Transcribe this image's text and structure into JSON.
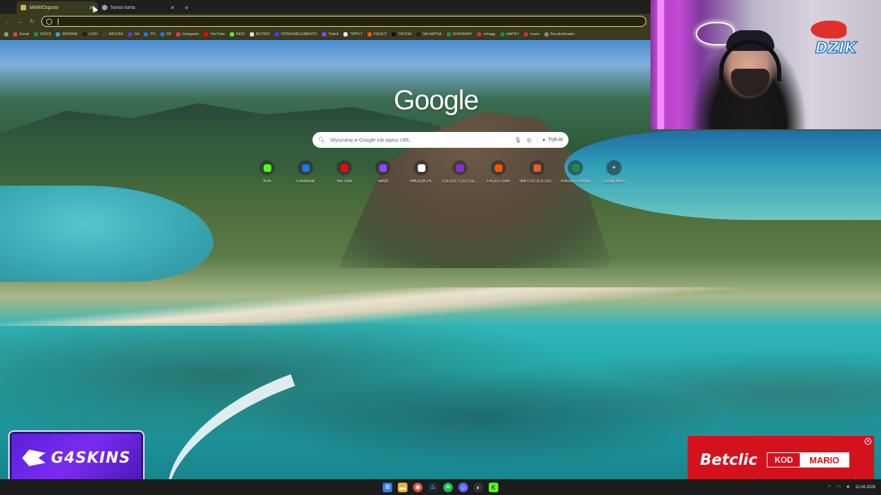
{
  "browser": {
    "tabs": [
      {
        "title": "MARIOspzoo",
        "active": true
      },
      {
        "title": "Nowa karta",
        "active": false
      }
    ],
    "new_tab_label": "+",
    "bookmarks": [
      {
        "label": "Gmail",
        "color": "#ea4335"
      },
      {
        "label": "DOCS",
        "color": "#1e8e3e"
      },
      {
        "label": "WFIRMA",
        "color": "#3aa0d8"
      },
      {
        "label": "LOGI",
        "color": "#202020"
      },
      {
        "label": "WKDZIK",
        "color": "#444444"
      },
      {
        "label": "G4",
        "color": "#7a2cf0"
      },
      {
        "label": "PS",
        "color": "#1a73e8"
      },
      {
        "label": "FB",
        "color": "#1877f2"
      },
      {
        "label": "Instagram",
        "color": "#e1306c"
      },
      {
        "label": "YouTube",
        "color": "#ff0000"
      },
      {
        "label": "KICK",
        "color": "#53fc18"
      },
      {
        "label": "BOTRIX",
        "color": "#dddddd"
      },
      {
        "label": "STREAMELEMENTS",
        "color": "#4d3aff"
      },
      {
        "label": "Twitch",
        "color": "#9146ff"
      },
      {
        "label": "TIPPLY",
        "color": "#ffffff"
      },
      {
        "label": "FACEIT",
        "color": "#ff5500"
      },
      {
        "label": "TIKTOK",
        "color": "#111111"
      },
      {
        "label": "NA HAPSA",
        "color": "#202020"
      },
      {
        "label": "GIVEAWAY",
        "color": "#1e8e3e"
      },
      {
        "label": "refragg",
        "color": "#d93025"
      },
      {
        "label": "HAPSY",
        "color": "#1e8e3e"
      },
      {
        "label": "muza",
        "color": "#d93025"
      },
      {
        "label": "PaczkaSmaku",
        "color": "#888888"
      }
    ]
  },
  "ntp": {
    "logo": "Google",
    "search_placeholder": "Wyszukaj w Google lub wpisz URL",
    "ai_mode": "Tryb AI",
    "shortcuts": [
      {
        "label": "Kick",
        "color": "#53fc18"
      },
      {
        "label": "Facebook",
        "color": "#1877f2"
      },
      {
        "label": "YouTube",
        "color": "#ff0000"
      },
      {
        "label": "Twitch",
        "color": "#9146ff"
      },
      {
        "label": "WKDZIK.PL",
        "color": "#ffffff"
      },
      {
        "label": "CS:GO / CS2 Ca...",
        "color": "#8a2be2"
      },
      {
        "label": "FACEIT.com",
        "color": "#ff5500"
      },
      {
        "label": "Sell CS2 (CS:GO...",
        "color": "#e06030"
      },
      {
        "label": "Arkusze Google",
        "color": "#1e8e3e"
      },
      {
        "label": "Dodaj skrót",
        "color": "#ffffff"
      }
    ]
  },
  "overlay": {
    "cam_brand": "DZIK",
    "g4_brand": "G4SKINS",
    "betclic_brand": "Betclic",
    "betclic_code_label": "KOD",
    "betclic_code": "MARIO"
  },
  "taskbar": {
    "time": "",
    "date": "11.04.2026"
  }
}
